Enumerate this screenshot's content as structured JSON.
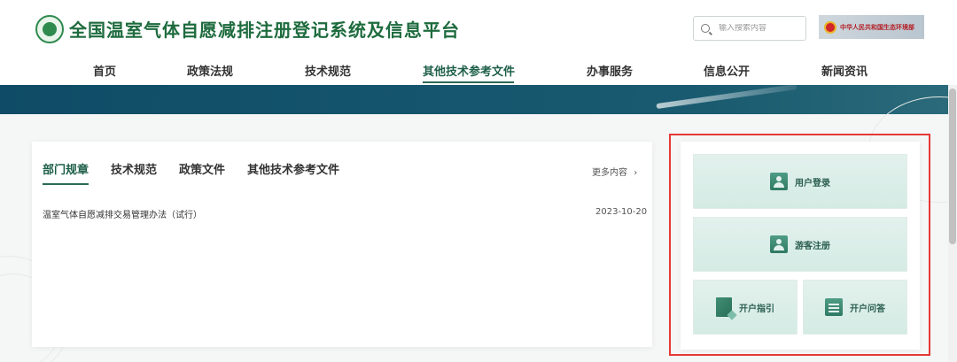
{
  "header": {
    "site_title": "全国温室气体自愿减排注册登记系统及信息平台",
    "search_placeholder": "输入搜索内容",
    "ministry_label": "中华人民共和国生态环境部"
  },
  "nav": {
    "items": [
      {
        "label": "首页"
      },
      {
        "label": "政策法规"
      },
      {
        "label": "技术规范"
      },
      {
        "label": "其他技术参考文件",
        "active": true
      },
      {
        "label": "办事服务"
      },
      {
        "label": "信息公开"
      },
      {
        "label": "新闻资讯"
      }
    ]
  },
  "news": {
    "tabs": [
      {
        "label": "部门规章",
        "active": true
      },
      {
        "label": "技术规范"
      },
      {
        "label": "政策文件"
      },
      {
        "label": "其他技术参考文件"
      }
    ],
    "more_label": "更多内容",
    "more_arrow": "›",
    "items": [
      {
        "title": "温室气体自愿减排交易管理办法（试行）",
        "date": "2023-10-20"
      }
    ]
  },
  "panel": {
    "login": "用户登录",
    "register": "游客注册",
    "guide": "开户指引",
    "faq": "开户问答"
  },
  "colors": {
    "brand_green": "#1e6b3e",
    "accent": "#2b6a55",
    "banner": "#0f4b66",
    "highlight": "#e53935"
  }
}
